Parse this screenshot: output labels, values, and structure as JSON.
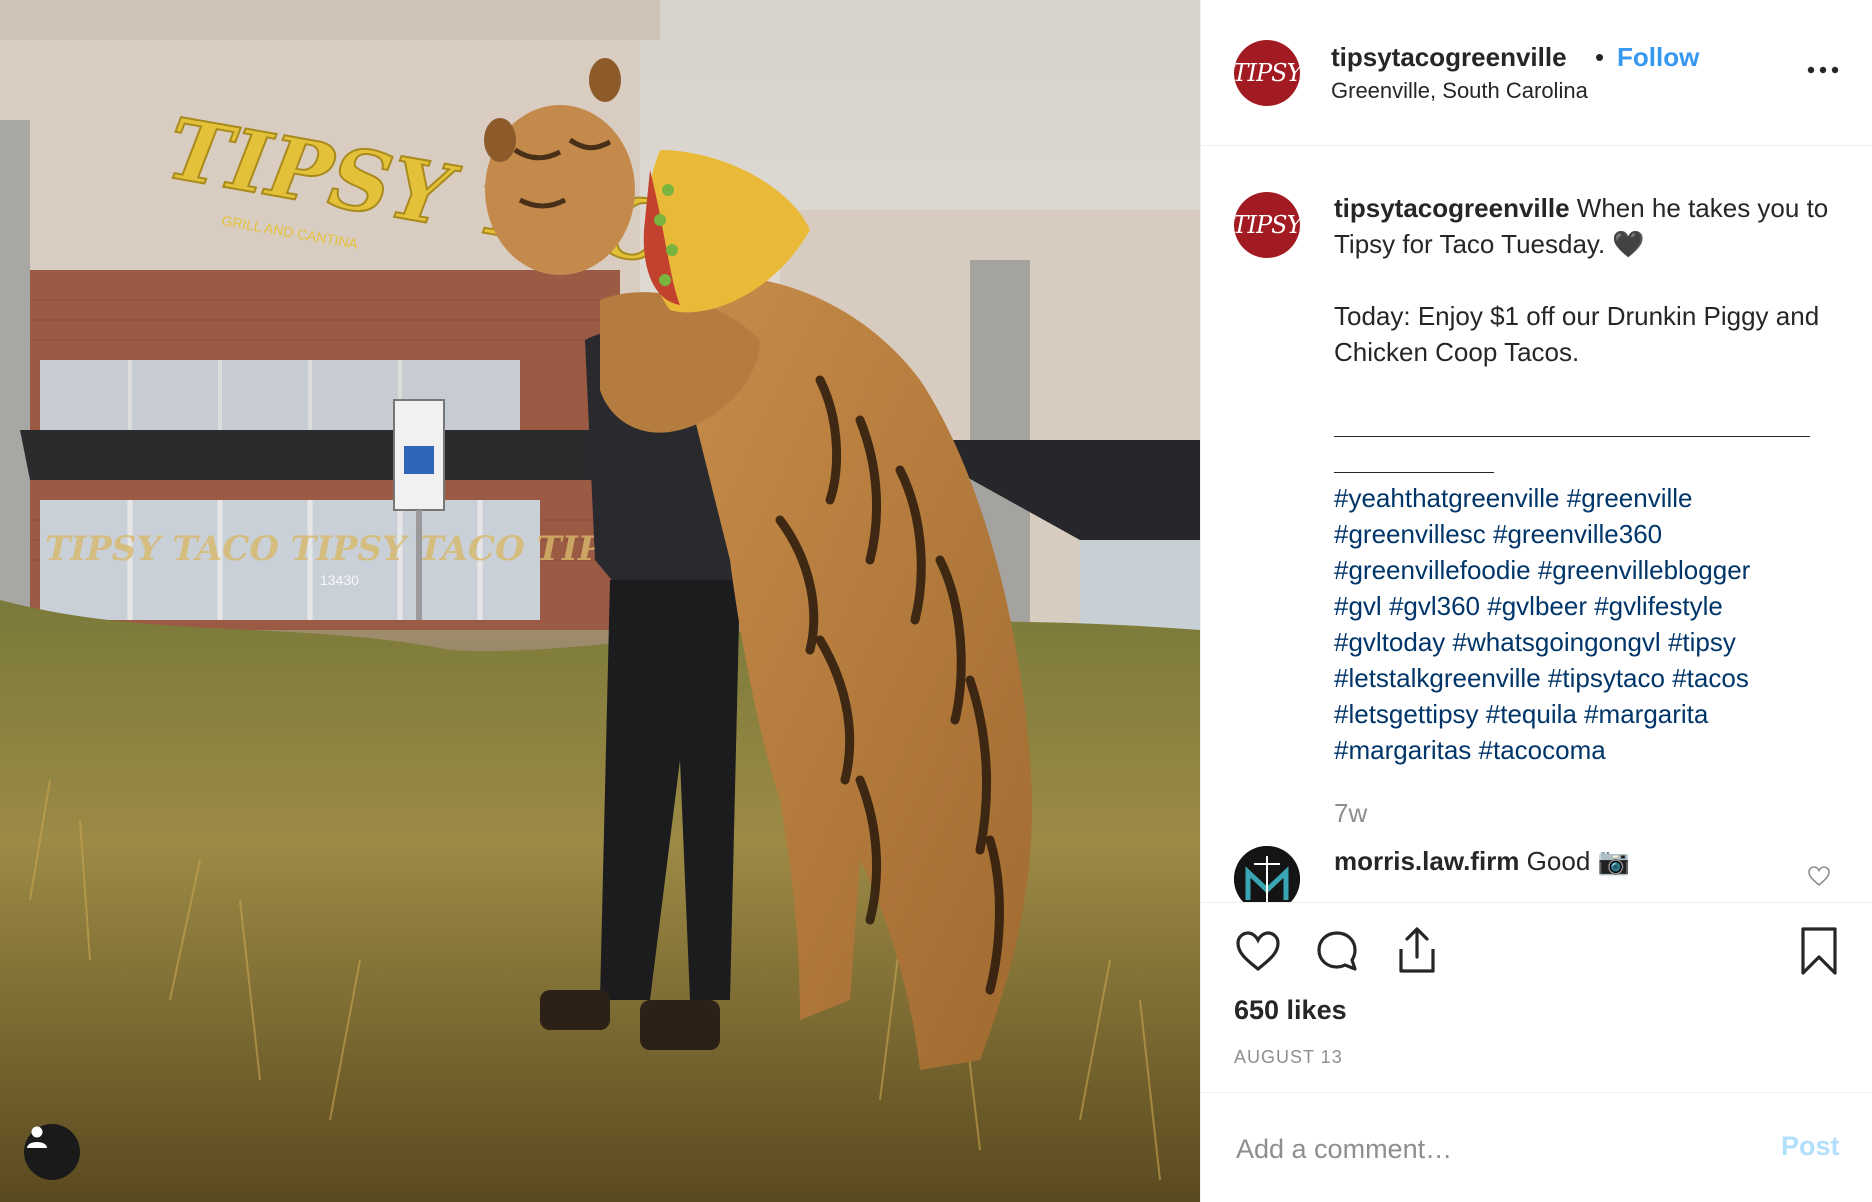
{
  "photo": {
    "sign_text": "TIPSY TACO",
    "sign_subtext": "GRILL AND CANTINA",
    "window_text": "TIPSY TACO TIPSY TACO TIPSY TACO",
    "address_number": "13430",
    "alt": ""
  },
  "header": {
    "avatar_text": "TIPSY",
    "username": "tipsytacogreenville",
    "separator": "•",
    "follow_label": "Follow",
    "location": "Greenville, South Carolina",
    "more_icon": "more-horizontal-icon"
  },
  "caption": {
    "avatar_text": "TIPSY",
    "username": "tipsytacogreenville",
    "text_line1": "When he takes you to Tipsy for Taco Tuesday. 🖤",
    "text_line2": "Today: Enjoy $1 off our Drunkin Piggy and Chicken Coop Tacos.",
    "hashtags": [
      "#yeahthatgreenville",
      "#greenville",
      "#greenvillesc",
      "#greenville360",
      "#greenvillefoodie",
      "#greenvilleblogger",
      "#gvl",
      "#gvl360",
      "#gvlbeer",
      "#gvlifestyle",
      "#gvltoday",
      "#whatsgoingongvl",
      "#tipsy",
      "#letstalkgreenville",
      "#tipsytaco",
      "#tacos",
      "#letsgettipsy",
      "#tequila",
      "#margarita",
      "#margaritas",
      "#tacocoma"
    ],
    "time": "7w"
  },
  "comment": {
    "username": "morris.law.firm",
    "text": "Good 📷"
  },
  "actions": {
    "likes": "650 likes",
    "date": "AUGUST 13"
  },
  "add_comment": {
    "placeholder": "Add a comment…",
    "post_label": "Post"
  },
  "colors": {
    "link_blue": "#3897f0",
    "hashtag_blue": "#003569",
    "muted": "#8e8e8e",
    "brand_red": "#a31b22",
    "post_disabled": "#b2dffc"
  }
}
